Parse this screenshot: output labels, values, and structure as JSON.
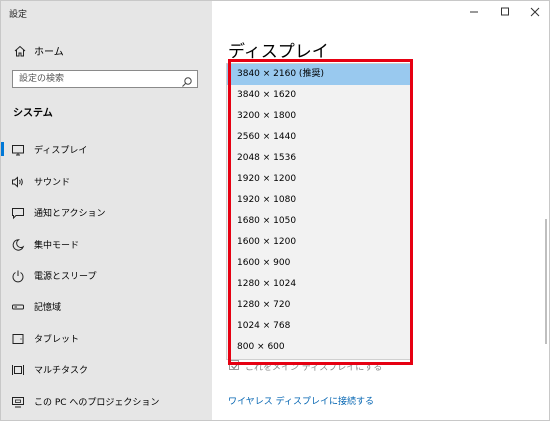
{
  "window": {
    "app_title": "設定"
  },
  "sidebar": {
    "home_label": "ホーム",
    "search_placeholder": "設定の検索",
    "section_title": "システム",
    "items": [
      {
        "label": "ディスプレイ",
        "icon": "monitor-icon",
        "active": true
      },
      {
        "label": "サウンド",
        "icon": "speaker-icon"
      },
      {
        "label": "通知とアクション",
        "icon": "notification-icon"
      },
      {
        "label": "集中モード",
        "icon": "moon-icon"
      },
      {
        "label": "電源とスリープ",
        "icon": "power-icon"
      },
      {
        "label": "記憶域",
        "icon": "storage-icon"
      },
      {
        "label": "タブレット",
        "icon": "tablet-icon"
      },
      {
        "label": "マルチタスク",
        "icon": "multitask-icon"
      },
      {
        "label": "この PC へのプロジェクション",
        "icon": "projection-icon"
      }
    ]
  },
  "main": {
    "page_title": "ディスプレイ",
    "resolution_options": [
      "3840 × 2160 (推奨)",
      "3840 × 1620",
      "3200 × 1800",
      "2560 × 1440",
      "2048 × 1536",
      "1920 × 1200",
      "1920 × 1080",
      "1680 × 1050",
      "1600 × 1200",
      "1600 × 900",
      "1280 × 1024",
      "1280 × 720",
      "1024 × 768",
      "800 × 600"
    ],
    "selected_resolution": "3840 × 2160 (推奨)",
    "partially_hidden_checkbox_label": "これをメイン ディスプレイにする",
    "wireless_link": "ワイヤレス ディスプレイに接続する"
  },
  "colors": {
    "accent": "#0078d7",
    "highlight_border": "#e60012",
    "selected_item": "#99c9ef",
    "link": "#0063b1"
  }
}
